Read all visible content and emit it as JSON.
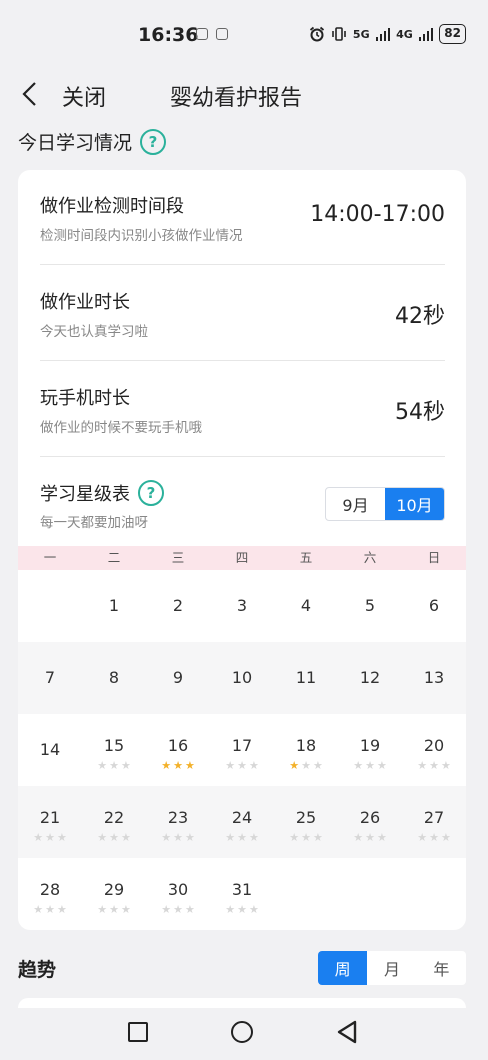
{
  "status": {
    "time": "16:36",
    "network1": "5G",
    "network2": "4G",
    "battery": "82"
  },
  "header": {
    "close_label": "关闭",
    "title": "婴幼看护报告"
  },
  "today": {
    "title": "今日学习情况",
    "help": "?",
    "rows": [
      {
        "title": "做作业检测时间段",
        "subtitle": "检测时间段内识别小孩做作业情况",
        "value": "14:00-17:00"
      },
      {
        "title": "做作业时长",
        "subtitle": "今天也认真学习啦",
        "value": "42秒"
      },
      {
        "title": "玩手机时长",
        "subtitle": "做作业的时候不要玩手机哦",
        "value": "54秒"
      }
    ]
  },
  "star_table": {
    "title": "学习星级表",
    "help": "?",
    "subtitle": "每一天都要加油呀",
    "months": [
      "9月",
      "10月"
    ],
    "active_month": 1,
    "weekdays": [
      "一",
      "二",
      "三",
      "四",
      "五",
      "六",
      "日"
    ],
    "weeks": [
      [
        {
          "d": ""
        },
        {
          "d": "1"
        },
        {
          "d": "2"
        },
        {
          "d": "3"
        },
        {
          "d": "4"
        },
        {
          "d": "5"
        },
        {
          "d": "6"
        }
      ],
      [
        {
          "d": "7"
        },
        {
          "d": "8"
        },
        {
          "d": "9"
        },
        {
          "d": "10"
        },
        {
          "d": "11"
        },
        {
          "d": "12"
        },
        {
          "d": "13"
        }
      ],
      [
        {
          "d": "14"
        },
        {
          "d": "15",
          "s": 0
        },
        {
          "d": "16",
          "s": 3
        },
        {
          "d": "17",
          "s": 0
        },
        {
          "d": "18",
          "s": 1
        },
        {
          "d": "19",
          "s": 0
        },
        {
          "d": "20",
          "s": 0
        }
      ],
      [
        {
          "d": "21",
          "s": 0
        },
        {
          "d": "22",
          "s": 0
        },
        {
          "d": "23",
          "s": 0
        },
        {
          "d": "24",
          "s": 0
        },
        {
          "d": "25",
          "s": 0
        },
        {
          "d": "26",
          "s": 0
        },
        {
          "d": "27",
          "s": 0
        }
      ],
      [
        {
          "d": "28",
          "s": 0
        },
        {
          "d": "29",
          "s": 0
        },
        {
          "d": "30",
          "s": 0
        },
        {
          "d": "31",
          "s": 0
        },
        {
          "d": ""
        },
        {
          "d": ""
        },
        {
          "d": ""
        }
      ]
    ],
    "star_glyph": "★",
    "star_on_color": "#f3b12a",
    "star_off_color": "#d7d7d7"
  },
  "trend": {
    "title": "趋势",
    "options": [
      "周",
      "月",
      "年"
    ],
    "active": 0
  },
  "colors": {
    "accent": "#1a7ff0",
    "help": "#2bb19b",
    "weekday_bg": "#fbe5ea"
  }
}
